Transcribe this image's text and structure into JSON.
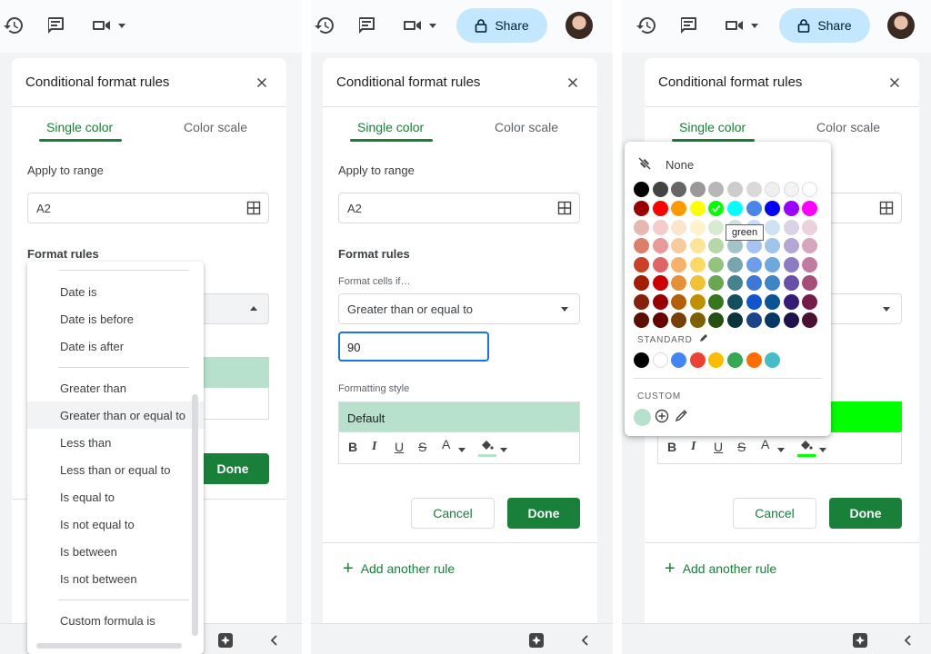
{
  "panel_1": {
    "title": "Conditional format rules",
    "tabs": [
      "Single color",
      "Color scale"
    ],
    "apply_range_label": "Apply to range",
    "range_value": "A2",
    "format_rules_label": "Format rules",
    "done_label": "Done",
    "menu": {
      "items": [
        "Date is",
        "Date is before",
        "Date is after",
        "Greater than",
        "Greater than or equal to",
        "Less than",
        "Less than or equal to",
        "Is equal to",
        "Is not equal to",
        "Is between",
        "Is not between",
        "Custom formula is"
      ],
      "highlighted": "Greater than or equal to"
    }
  },
  "panel_2": {
    "share_label": "Share",
    "title": "Conditional format rules",
    "tabs": [
      "Single color",
      "Color scale"
    ],
    "apply_range_label": "Apply to range",
    "range_value": "A2",
    "format_rules_label": "Format rules",
    "format_cells_if_label": "Format cells if…",
    "condition": "Greater than or equal to",
    "value": "90",
    "formatting_style_label": "Formatting style",
    "style_preview": "Default",
    "cancel_label": "Cancel",
    "done_label": "Done",
    "add_rule_label": "Add another rule",
    "text_style_tools": [
      "B",
      "I",
      "U",
      "S",
      "A"
    ]
  },
  "panel_3": {
    "share_label": "Share",
    "title": "Conditional format rules",
    "tabs": [
      "Single color",
      "Color scale"
    ],
    "cancel_label": "Cancel",
    "done_label": "Done",
    "add_rule_label": "Add another rule",
    "picker": {
      "none_label": "None",
      "standard_label": "STANDARD",
      "custom_label": "CUSTOM",
      "tooltip": "green",
      "selected_color": "#00ff00",
      "standard_colors": [
        "#000000",
        "#ffffff",
        "#4285f4",
        "#ea4335",
        "#fbbc04",
        "#34a853",
        "#ff6d01",
        "#46bdc6"
      ],
      "custom_colors": [
        "#b7e1cd"
      ]
    }
  },
  "colors": {
    "accent_green": "#188038",
    "share_bg": "#c2e7ff",
    "default_style_bg": "#b7e1cd",
    "focus_blue": "#1a73e8"
  }
}
